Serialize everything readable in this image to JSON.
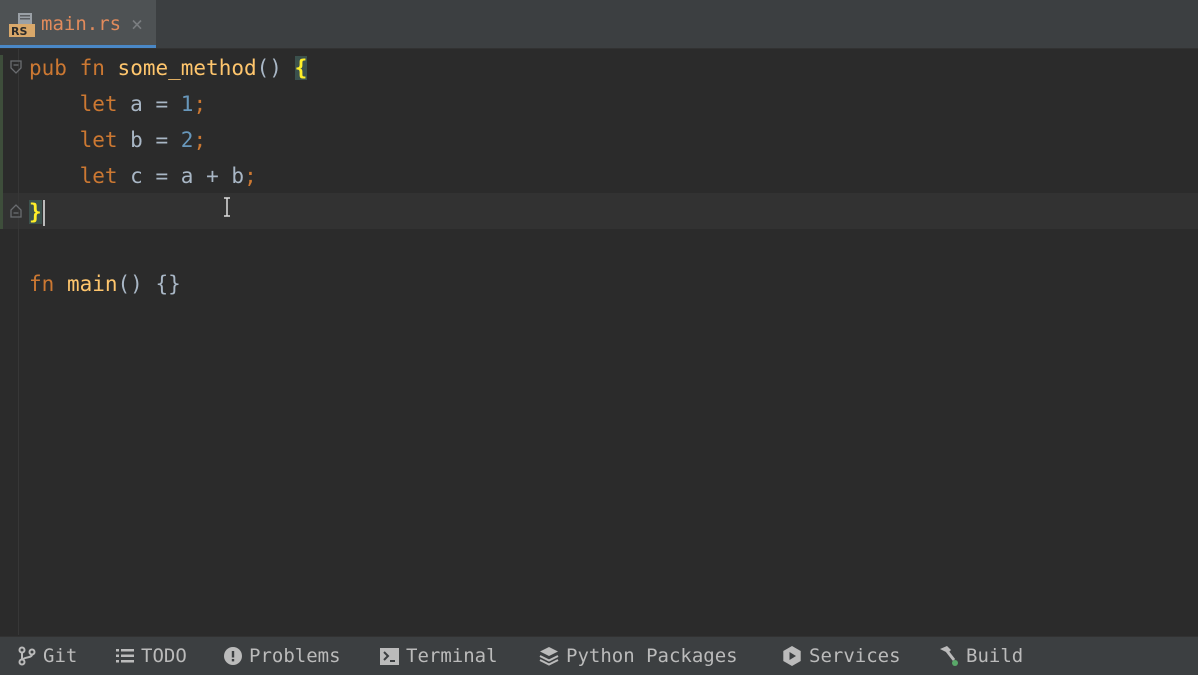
{
  "tab": {
    "badge": "RS",
    "label": "main.rs",
    "close": "×"
  },
  "code": {
    "line1": {
      "kw1": "pub",
      "kw2": "fn",
      "name": "some_method",
      "parens": "()",
      "brace": "{"
    },
    "line2": {
      "kw": "let",
      "lhs": "a",
      "op": "=",
      "num": "1",
      "semi": ";"
    },
    "line3": {
      "kw": "let",
      "lhs": "b",
      "op": "=",
      "num": "2",
      "semi": ";"
    },
    "line4": {
      "kw": "let",
      "lhs": "c",
      "op": "=",
      "a": "a",
      "plus": "+",
      "b": "b",
      "semi": ";"
    },
    "line5": {
      "brace": "}"
    },
    "line7": {
      "kw": "fn",
      "name": "main",
      "parens": "()",
      "braces": "{}"
    }
  },
  "toolwindows": {
    "git": "Git",
    "todo": "TODO",
    "problems": "Problems",
    "terminal": "Terminal",
    "python_packages": "Python Packages",
    "services": "Services",
    "build": "Build"
  }
}
